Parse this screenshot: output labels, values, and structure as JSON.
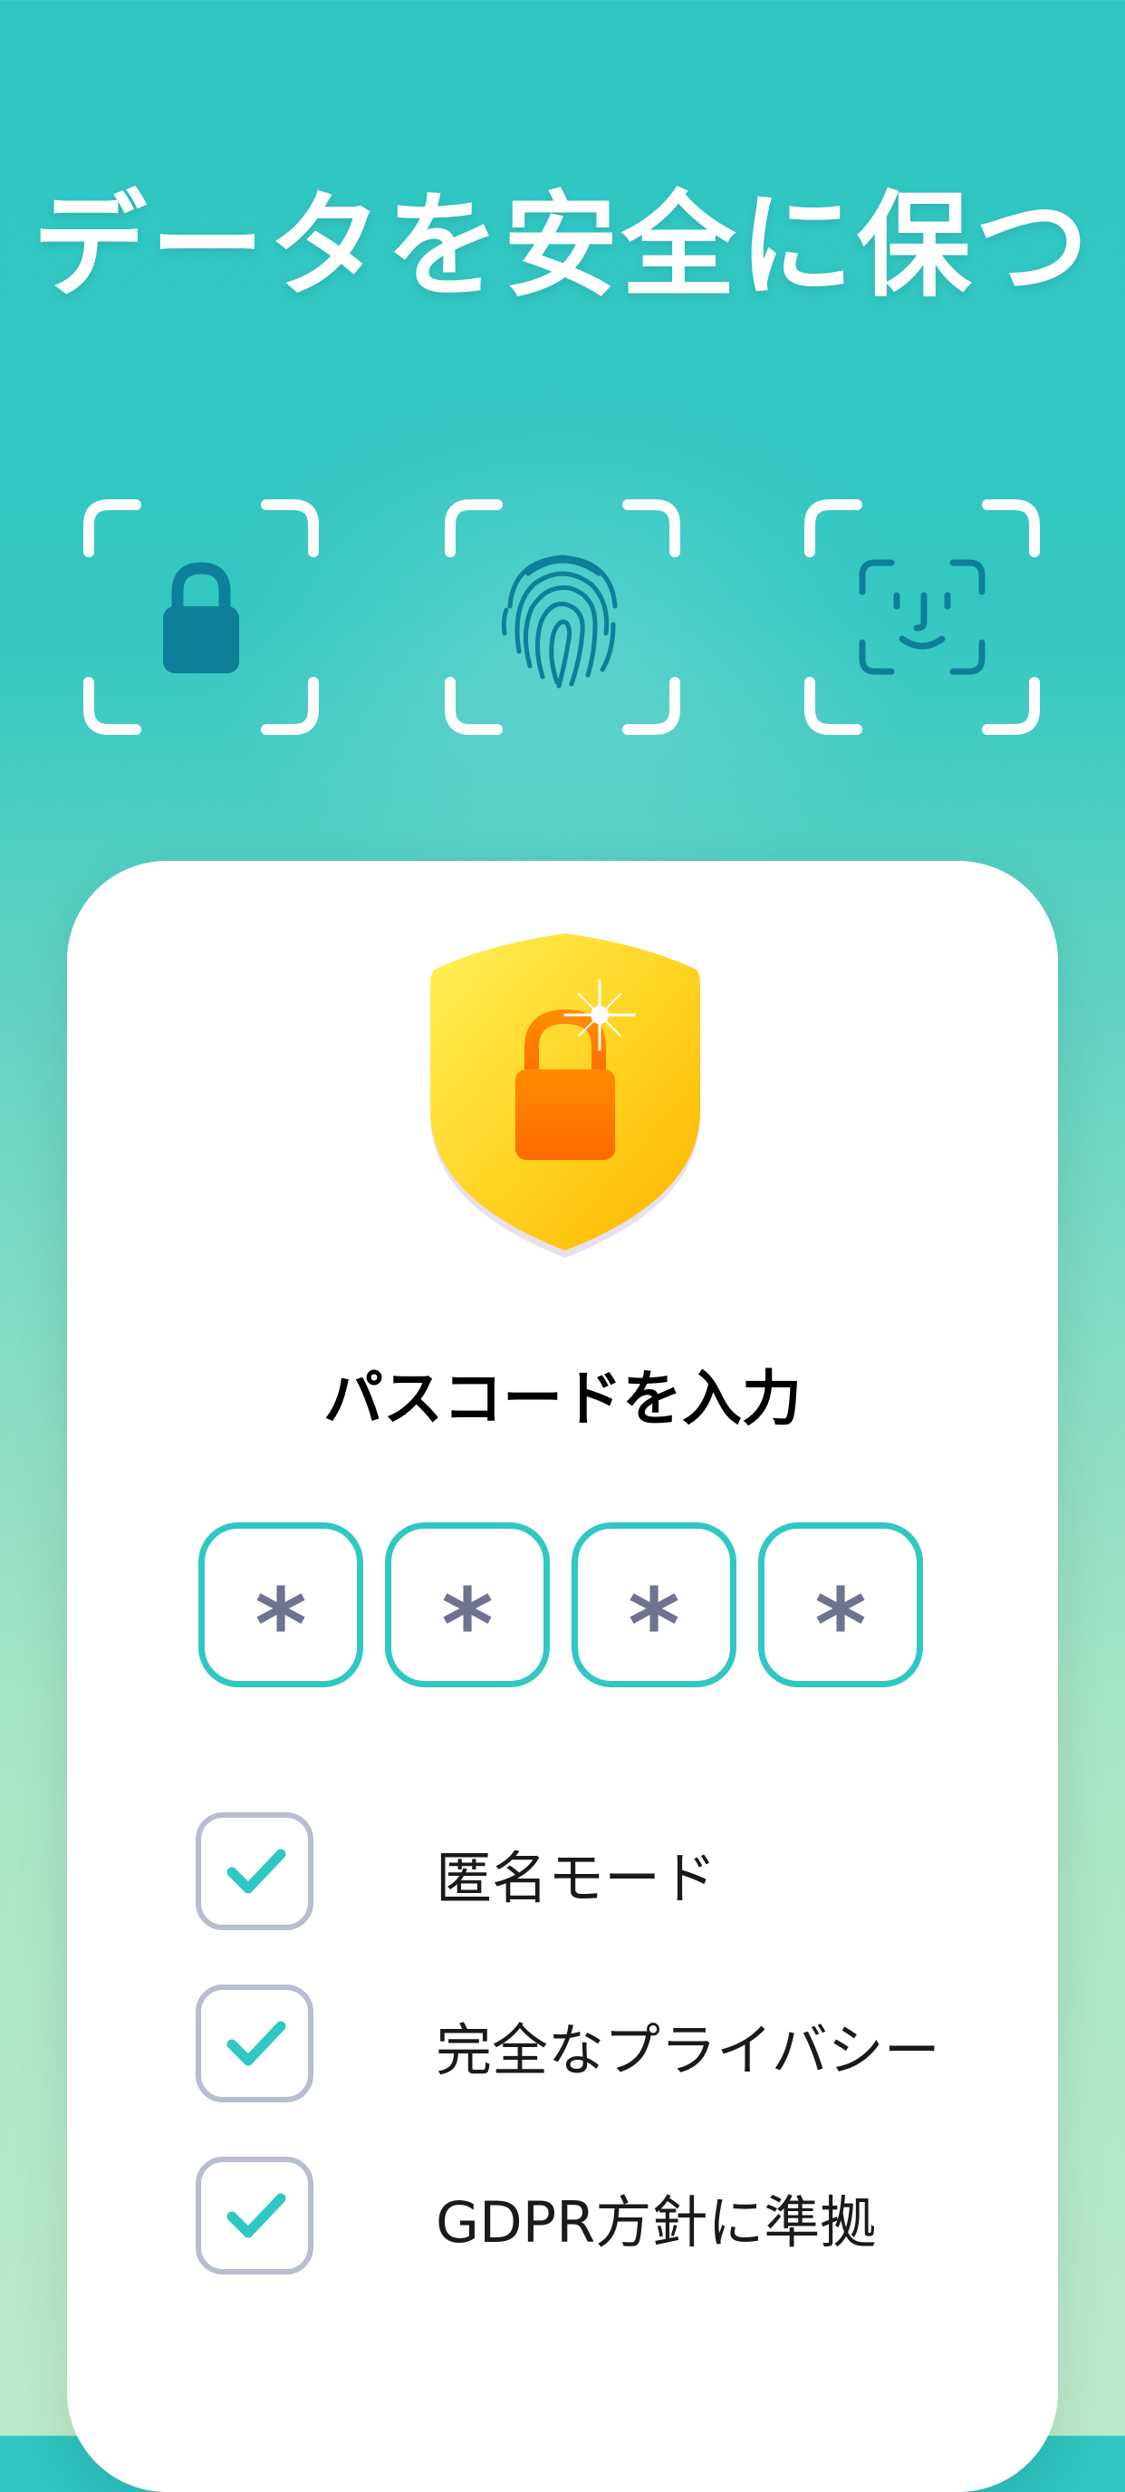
{
  "headline": "データを安全に保つ",
  "security_methods": [
    {
      "name": "passcode",
      "icon": "lock-icon"
    },
    {
      "name": "fingerprint",
      "icon": "fingerprint-icon"
    },
    {
      "name": "face-id",
      "icon": "face-id-icon"
    }
  ],
  "card": {
    "badge_icon": "shield-lock-icon",
    "title": "パスコードを入力",
    "pin_digits": [
      "*",
      "*",
      "*",
      "*"
    ],
    "features": [
      {
        "label": "匿名モード",
        "checked": true
      },
      {
        "label": "完全なプライバシー",
        "checked": true
      },
      {
        "label": "GDPR方針に準拠",
        "checked": true
      }
    ]
  },
  "colors": {
    "accent_teal": "#2fc8c4",
    "icon_teal": "#0e7f99",
    "shield_yellow": "#ffd21f",
    "lock_orange": "#ff7a00",
    "pin_text": "#6f7390",
    "checkbox_border": "#b8bdd0"
  }
}
